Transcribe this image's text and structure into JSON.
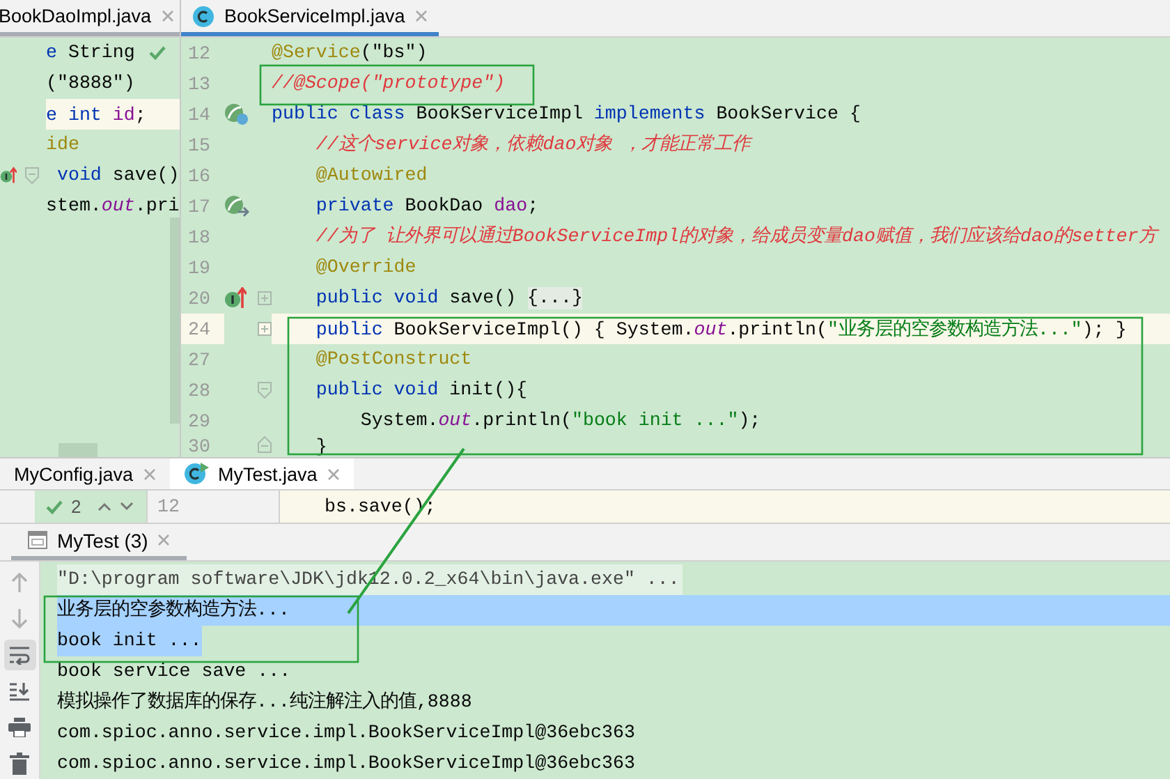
{
  "top_editors": {
    "left_pane": {
      "tab": {
        "label": "BookDaoImpl.java",
        "selected": true
      },
      "lines": [
        {
          "tokens": [
            {
              "text": "e",
              "kind": "keyword"
            },
            {
              "text": " String",
              "kind": "plain"
            }
          ],
          "current": false
        },
        {
          "tokens": [
            {
              "text": "(\"8888\")",
              "kind": "plain"
            }
          ],
          "current": false
        },
        {
          "tokens": [
            {
              "text": "e int ",
              "kind": "keyword"
            },
            {
              "text": "id",
              "kind": "field"
            },
            {
              "text": ";",
              "kind": "plain"
            }
          ],
          "current": true
        },
        {
          "tokens": [
            {
              "text": "ide",
              "kind": "annotation"
            }
          ],
          "current": false
        },
        {
          "tokens": [
            {
              "text": " void",
              "kind": "keyword"
            },
            {
              "text": " save()",
              "kind": "plain"
            }
          ],
          "current": false
        },
        {
          "tokens": [
            {
              "text": "stem.",
              "kind": "plain"
            },
            {
              "text": "out",
              "kind": "static"
            },
            {
              "text": ".pri",
              "kind": "plain"
            }
          ],
          "current": false
        }
      ]
    },
    "right_pane": {
      "tab": {
        "label": "BookServiceImpl.java",
        "selected": true
      },
      "lines": [
        {
          "number": "12",
          "tokens": [
            {
              "text": "@Service",
              "kind": "annotation"
            },
            {
              "text": "(\"bs\")",
              "kind": "plain"
            }
          ],
          "current": false
        },
        {
          "number": "13",
          "tokens": [
            {
              "text": "//@Scope(\"prototype\")",
              "kind": "comment"
            }
          ],
          "current": false
        },
        {
          "number": "14",
          "tokens": [
            {
              "text": "public class",
              "kind": "keyword"
            },
            {
              "text": " BookServiceImpl ",
              "kind": "plain"
            },
            {
              "text": "implements",
              "kind": "keyword"
            },
            {
              "text": " BookService {",
              "kind": "plain"
            }
          ],
          "current": false
        },
        {
          "number": "15",
          "tokens": [
            {
              "text": "    //这个service对象，依赖dao对象 ，才能正常工作",
              "kind": "comment"
            }
          ],
          "current": false
        },
        {
          "number": "16",
          "tokens": [
            {
              "text": "    @Autowired",
              "kind": "annotation"
            }
          ],
          "current": false
        },
        {
          "number": "17",
          "tokens": [
            {
              "text": "    private",
              "kind": "keyword"
            },
            {
              "text": " BookDao ",
              "kind": "plain"
            },
            {
              "text": "dao",
              "kind": "field"
            },
            {
              "text": ";",
              "kind": "plain"
            }
          ],
          "current": false
        },
        {
          "number": "18",
          "tokens": [
            {
              "text": "    //为了 让外界可以通过BookServiceImpl的对象，给成员变量dao赋值，我们应该给dao的setter方",
              "kind": "comment"
            }
          ],
          "current": false
        },
        {
          "number": "19",
          "tokens": [
            {
              "text": "    @Override",
              "kind": "annotation"
            }
          ],
          "current": false
        },
        {
          "number": "20",
          "tokens": [
            {
              "text": "    public void",
              "kind": "keyword"
            },
            {
              "text": " save() ",
              "kind": "plain"
            },
            {
              "text": "{...}",
              "kind": "folded"
            }
          ],
          "current": false
        },
        {
          "number": "24",
          "tokens": [
            {
              "text": "    public",
              "kind": "keyword"
            },
            {
              "text": " BookServiceImpl() { System.",
              "kind": "plain"
            },
            {
              "text": "out",
              "kind": "static"
            },
            {
              "text": ".println(",
              "kind": "plain"
            },
            {
              "text": "\"业务层的空参数构造方法...\"",
              "kind": "string"
            },
            {
              "text": "); }",
              "kind": "plain"
            }
          ],
          "current": true
        },
        {
          "number": "27",
          "tokens": [
            {
              "text": "    @PostConstruct",
              "kind": "annotation"
            }
          ],
          "current": false
        },
        {
          "number": "28",
          "tokens": [
            {
              "text": "    public void",
              "kind": "keyword"
            },
            {
              "text": " init(){",
              "kind": "plain"
            }
          ],
          "current": false
        },
        {
          "number": "29",
          "tokens": [
            {
              "text": "        System.",
              "kind": "plain"
            },
            {
              "text": "out",
              "kind": "static"
            },
            {
              "text": ".println(",
              "kind": "plain"
            },
            {
              "text": "\"book init ...\"",
              "kind": "string"
            },
            {
              "text": ");",
              "kind": "plain"
            }
          ],
          "current": false
        },
        {
          "number": "30",
          "tokens": [
            {
              "text": "    }",
              "kind": "plain"
            }
          ],
          "current": false
        }
      ]
    }
  },
  "bottom_tabs": [
    {
      "label": "MyConfig.java",
      "selected": false
    },
    {
      "label": "MyTest.java",
      "selected": true
    }
  ],
  "bottom_editor": {
    "problem_count": "2",
    "line_number": "12",
    "code": "bs.save();"
  },
  "run_panel": {
    "tab": {
      "label": "MyTest (3)",
      "selected": true
    },
    "toolbar": [
      {
        "kind": "up",
        "on": false,
        "disabled": true
      },
      {
        "kind": "down",
        "on": false,
        "disabled": true
      },
      {
        "kind": "wrap",
        "on": true,
        "disabled": false
      },
      {
        "kind": "scroll-end",
        "on": false,
        "disabled": false
      },
      {
        "kind": "print",
        "on": false,
        "disabled": false
      },
      {
        "kind": "trash",
        "on": false,
        "disabled": false
      }
    ],
    "console": [
      {
        "text": "\"D:\\program software\\JDK\\jdk12.0.2_x64\\bin\\java.exe\" ...",
        "kind": "command",
        "selected": false
      },
      {
        "text": "业务层的空参数构造方法...",
        "kind": "output",
        "selected": true
      },
      {
        "text": "book init ...",
        "kind": "output",
        "selected": true
      },
      {
        "text": "book service save ...",
        "kind": "output",
        "selected": false
      },
      {
        "text": "模拟操作了数据库的保存...纯注解注入的值,8888",
        "kind": "output",
        "selected": false
      },
      {
        "text": "com.spioc.anno.service.impl.BookServiceImpl@36ebc363",
        "kind": "output",
        "selected": false
      },
      {
        "text": "com.spioc.anno.service.impl.BookServiceImpl@36ebc363",
        "kind": "output",
        "selected": false
      }
    ]
  },
  "markup": [
    {
      "kind": "frame"
    },
    {
      "kind": "frame"
    },
    {
      "kind": "frame"
    },
    {
      "kind": "leader"
    }
  ]
}
